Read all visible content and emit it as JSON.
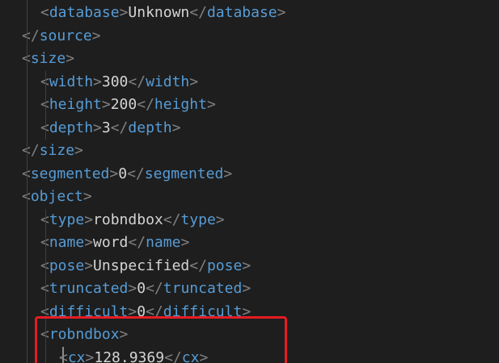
{
  "lines": [
    {
      "indent": 1,
      "tag": "database",
      "text": "Unknown",
      "kind": "pair"
    },
    {
      "indent": 0,
      "tag": "source",
      "kind": "close"
    },
    {
      "indent": 0,
      "tag": "size",
      "kind": "open"
    },
    {
      "indent": 1,
      "tag": "width",
      "text": "300",
      "kind": "pair"
    },
    {
      "indent": 1,
      "tag": "height",
      "text": "200",
      "kind": "pair"
    },
    {
      "indent": 1,
      "tag": "depth",
      "text": "3",
      "kind": "pair"
    },
    {
      "indent": 0,
      "tag": "size",
      "kind": "close"
    },
    {
      "indent": 0,
      "tag": "segmented",
      "text": "0",
      "kind": "pair"
    },
    {
      "indent": 0,
      "tag": "object",
      "kind": "open"
    },
    {
      "indent": 1,
      "tag": "type",
      "text": "robndbox",
      "kind": "pair"
    },
    {
      "indent": 1,
      "tag": "name",
      "text": "word",
      "kind": "pair"
    },
    {
      "indent": 1,
      "tag": "pose",
      "text": "Unspecified",
      "kind": "pair"
    },
    {
      "indent": 1,
      "tag": "truncated",
      "text": "0",
      "kind": "pair"
    },
    {
      "indent": 1,
      "tag": "difficult",
      "text": "0",
      "kind": "pair"
    },
    {
      "indent": 1,
      "tag": "robndbox",
      "kind": "open"
    },
    {
      "indent": 2,
      "tag": "cx",
      "text": "128.9369",
      "kind": "pair"
    }
  ],
  "colors": {
    "background": "#1e1e1e",
    "tag": "#569cd6",
    "bracket": "#808080",
    "text": "#d4d4d4",
    "highlight": "#e51c23"
  }
}
